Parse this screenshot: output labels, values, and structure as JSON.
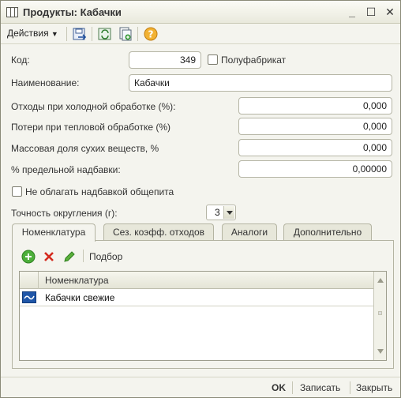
{
  "window": {
    "title": "Продукты: Кабачки"
  },
  "toolbar": {
    "actions_label": "Действия"
  },
  "form": {
    "code_label": "Код:",
    "code_value": "349",
    "semifinished_label": "Полуфабрикат",
    "name_label": "Наименование:",
    "name_value": "Кабачки",
    "cold_waste_label": "Отходы при холодной обработке (%):",
    "cold_waste_value": "0,000",
    "heat_loss_label": "Потери при тепловой обработке (%)",
    "heat_loss_value": "0,000",
    "dry_matter_label": "Массовая доля сухих веществ, %",
    "dry_matter_value": "0,000",
    "markup_label": "% предельной надбавки:",
    "markup_value": "0,00000",
    "no_markup_label": "Не облагать надбавкой общепита",
    "rounding_label": "Точность округления (г):",
    "rounding_value": "3"
  },
  "tabs": [
    {
      "label": "Номенклатура"
    },
    {
      "label": "Сез. коэфф. отходов"
    },
    {
      "label": "Аналоги"
    },
    {
      "label": "Дополнительно"
    }
  ],
  "tab_toolbar": {
    "pick_label": "Подбор"
  },
  "table": {
    "header": "Номенклатура",
    "rows": [
      {
        "name": "Кабачки свежие"
      }
    ]
  },
  "footer": {
    "ok_label": "OK",
    "save_label": "Записать",
    "close_label": "Закрыть"
  }
}
